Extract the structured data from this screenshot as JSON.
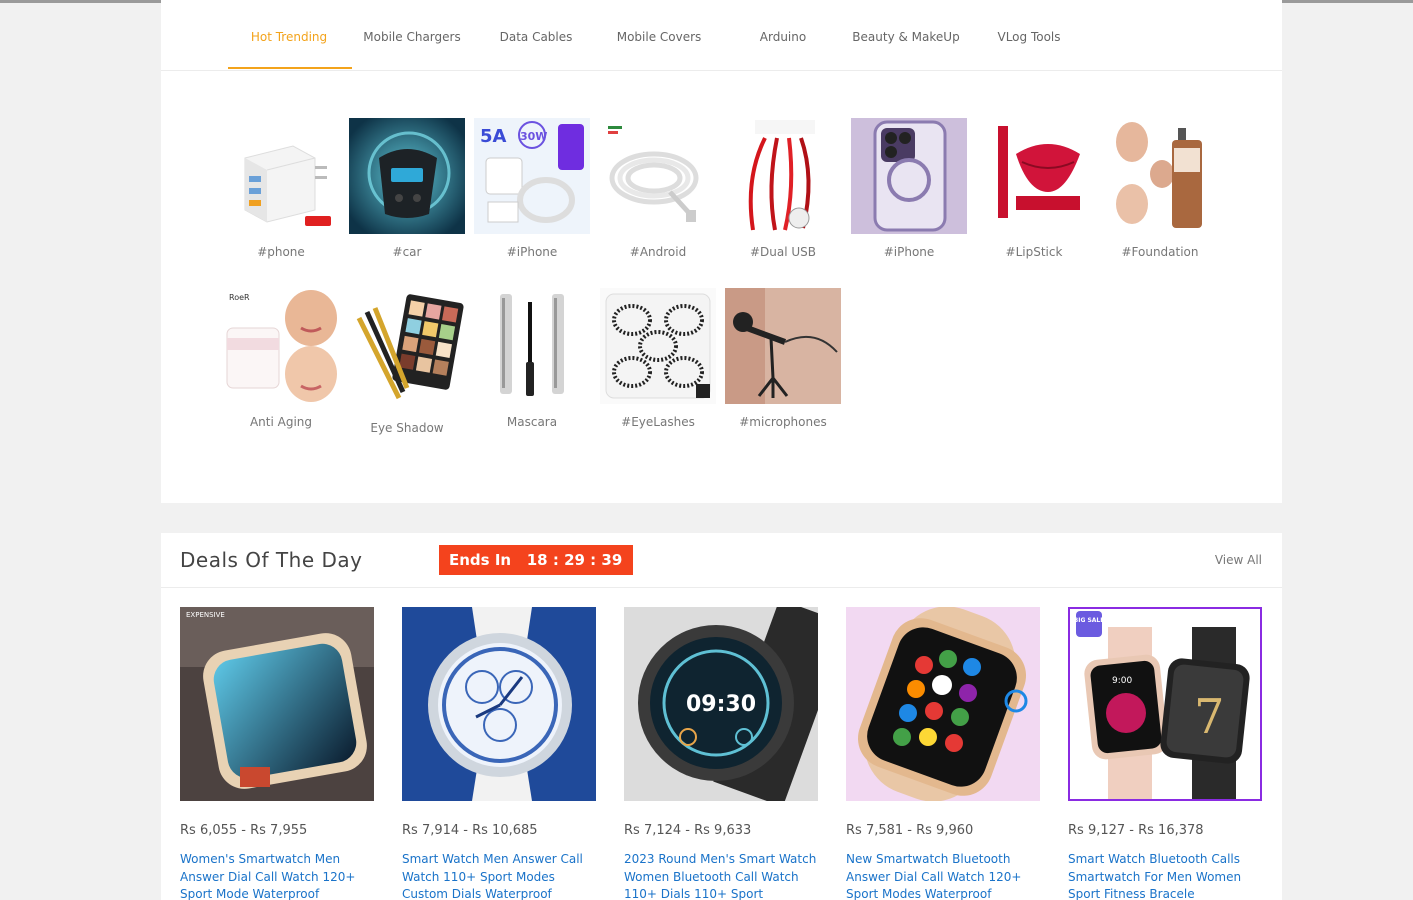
{
  "tabs": [
    {
      "label": "Hot Trending",
      "active": true
    },
    {
      "label": "Mobile Chargers"
    },
    {
      "label": "Data Cables"
    },
    {
      "label": "Mobile Covers"
    },
    {
      "label": "Arduino"
    },
    {
      "label": "Beauty & MakeUp"
    },
    {
      "label": "VLog Tools"
    }
  ],
  "categories": [
    {
      "label": "#phone",
      "icon": "charger-image"
    },
    {
      "label": "#car",
      "icon": "car-charger-image"
    },
    {
      "label": "#iPhone",
      "icon": "iphone-charger-image"
    },
    {
      "label": "#Android",
      "icon": "cable-image"
    },
    {
      "label": "#Dual USB",
      "icon": "usb-cable-image"
    },
    {
      "label": "#iPhone",
      "icon": "phone-case-image"
    },
    {
      "label": "#LipStick",
      "icon": "lipstick-image"
    },
    {
      "label": "#Foundation",
      "icon": "foundation-image"
    },
    {
      "label": "Anti Aging",
      "icon": "cream-image"
    },
    {
      "label": "Eye Shadow",
      "icon": "palette-image"
    },
    {
      "label": "Mascara",
      "icon": "mascara-image"
    },
    {
      "label": "#EyeLashes",
      "icon": "eyelashes-image"
    },
    {
      "label": "#microphones",
      "icon": "microphone-image"
    }
  ],
  "deals": {
    "title": "Deals Of The Day",
    "timer_label": "Ends In",
    "timer_value": "18 : 29 : 39",
    "view_all": "View All",
    "products": [
      {
        "price": "Rs 6,055 - Rs 7,955",
        "name": "Women's Smartwatch Men Answer Dial Call Watch 120+ Sport Mode Waterproof"
      },
      {
        "price": "Rs 7,914 - Rs 10,685",
        "name": "Smart Watch Men Answer Call Watch 110+ Sport Modes Custom Dials Waterproof"
      },
      {
        "price": "Rs 7,124 - Rs 9,633",
        "name": "2023 Round Men's Smart Watch Women Bluetooth Call Watch 110+ Dials 110+ Sport"
      },
      {
        "price": "Rs 7,581 - Rs 9,960",
        "name": "New Smartwatch Bluetooth Answer Dial Call Watch 120+ Sport Modes Waterproof"
      },
      {
        "price": "Rs 9,127 - Rs 16,378",
        "name": "Smart Watch Bluetooth Calls Smartwatch For Men Women Sport Fitness Bracele",
        "badge": "BIG SALE",
        "selected": true
      }
    ],
    "product_extra_labels": [
      "EXPENSIVE",
      "09:30",
      "9:00",
      "7"
    ]
  },
  "colors": {
    "accent": "#f3a31b",
    "timer_bg": "#f4431d",
    "link": "#1a73c9",
    "selected_outline": "#8a2be2"
  }
}
